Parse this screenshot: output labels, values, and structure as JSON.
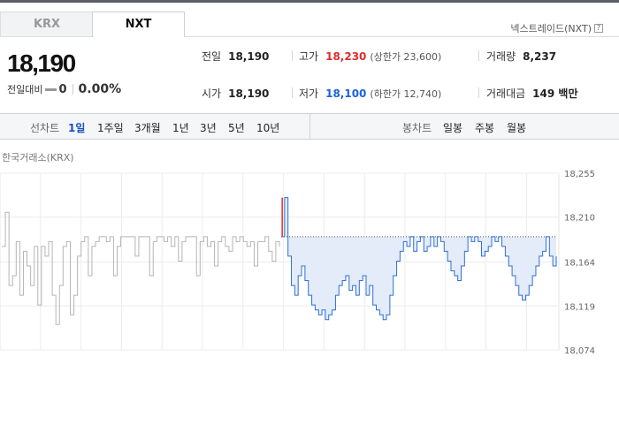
{
  "tabs": [
    {
      "label": "KRX",
      "active": false
    },
    {
      "label": "NXT",
      "active": true
    }
  ],
  "nxt_link": {
    "label": "넥스트레이드(NXT)",
    "help": "?"
  },
  "quote": {
    "price": "18,190",
    "change_label": "전일대비",
    "change_value": "0",
    "change_rate": "0.00%"
  },
  "stats": {
    "prev_close": {
      "label": "전일",
      "value": "18,190"
    },
    "open": {
      "label": "시가",
      "value": "18,190"
    },
    "high": {
      "label": "고가",
      "value": "18,230",
      "sub": "(상한가 23,600)"
    },
    "low": {
      "label": "저가",
      "value": "18,100",
      "sub": "(하한가 12,740)"
    },
    "volume": {
      "label": "거래량",
      "value": "8,237"
    },
    "amount": {
      "label": "거래대금",
      "value": "149 백만"
    }
  },
  "periods": {
    "label": "선차트",
    "items": [
      "1일",
      "1주일",
      "3개월",
      "1년",
      "3년",
      "5년",
      "10년"
    ],
    "active": 0
  },
  "candles": {
    "label": "봉차트",
    "items": [
      "일봉",
      "주봉",
      "월봉"
    ]
  },
  "chart_data": {
    "type": "line",
    "title": "한국거래소(KRX)",
    "ylim": [
      18074,
      18255
    ],
    "yticks": [
      "18,255",
      "18,210",
      "18,164",
      "18,119",
      "18,074"
    ],
    "reference_line": 18190,
    "series": [
      {
        "color": "#b5b5b5",
        "values": [
          18180,
          18215,
          18140,
          18150,
          18185,
          18130,
          18175,
          18160,
          18140,
          18180,
          18120,
          18180,
          18170,
          18185,
          18130,
          18100,
          18140,
          18180,
          18185,
          18110,
          18130,
          18170,
          18185,
          18190,
          18150,
          18180,
          18185,
          18190,
          18190,
          18185,
          18190,
          18150,
          18180,
          18190,
          18190,
          18190,
          18190,
          18170,
          18190,
          18190,
          18190,
          18150,
          18185,
          18190,
          18190,
          18185,
          18190,
          18180,
          18190,
          18165,
          18185,
          18190,
          18190,
          18190,
          18150,
          18185,
          18190,
          18180,
          18185,
          18160,
          18185,
          18190,
          18180,
          18175,
          18190,
          18185,
          18190,
          18185,
          18180,
          18185,
          18160,
          18185,
          18185,
          18190,
          18175,
          18165,
          18185,
          18180
        ]
      },
      {
        "name": "NXT",
        "color": "#2f6fd8",
        "fill": "#e3ecf8",
        "values": [
          18190,
          18230,
          18170,
          18140,
          18130,
          18150,
          18160,
          18145,
          18130,
          18120,
          18115,
          18110,
          18115,
          18105,
          18110,
          18115,
          18130,
          18140,
          18145,
          18150,
          18135,
          18140,
          18130,
          18145,
          18150,
          18130,
          18140,
          18120,
          18115,
          18110,
          18105,
          18110,
          18130,
          18150,
          18165,
          18175,
          18185,
          18180,
          18190,
          18175,
          18185,
          18190,
          18175,
          18180,
          18190,
          18180,
          18190,
          18185,
          18175,
          18165,
          18155,
          18150,
          18145,
          18160,
          18175,
          18190,
          18185,
          18190,
          18185,
          18170,
          18175,
          18180,
          18190,
          18185,
          18190,
          18180,
          18170,
          18160,
          18150,
          18140,
          18130,
          18125,
          18130,
          18140,
          18150,
          18160,
          18170,
          18175,
          18190,
          18170,
          18160,
          18170
        ]
      }
    ]
  }
}
